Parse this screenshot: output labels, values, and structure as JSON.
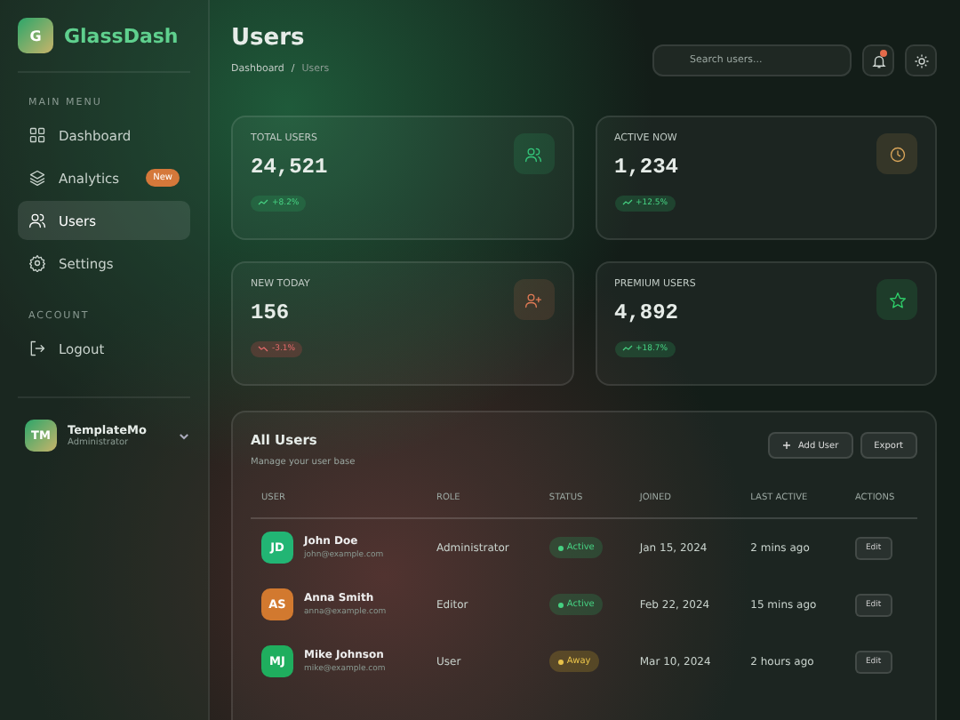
{
  "brand": {
    "logo_letter": "G",
    "name": "GlassDash"
  },
  "sidebar": {
    "sections": [
      {
        "title": "MAIN MENU",
        "items": [
          {
            "label": "Dashboard",
            "kind": "grid",
            "selected": false
          },
          {
            "label": "Analytics",
            "kind": "layers",
            "selected": false,
            "badge": "New"
          },
          {
            "label": "Users",
            "kind": "users",
            "selected": true
          },
          {
            "label": "Settings",
            "kind": "gear",
            "selected": false
          }
        ]
      },
      {
        "title": "ACCOUNT",
        "items": [
          {
            "label": "Logout",
            "kind": "logout",
            "selected": false
          }
        ]
      }
    ],
    "profile": {
      "initials": "TM",
      "name": "TemplateMo",
      "role": "Administrator"
    }
  },
  "header": {
    "title": "Users",
    "breadcrumb": [
      "Dashboard",
      "/",
      "Users"
    ],
    "search": {
      "placeholder": "Search users..."
    },
    "notification_dot": true
  },
  "stats": [
    {
      "label": "TOTAL USERS",
      "value": "24,521",
      "change": {
        "text": "+8.2%",
        "kind": "up"
      },
      "kind": "users",
      "color": "#34c77b"
    },
    {
      "label": "ACTIVE NOW",
      "value": "1,234",
      "change": {
        "text": "+12.5%",
        "kind": "up"
      },
      "kind": "clock",
      "color": "#d9a55a"
    },
    {
      "label": "NEW TODAY",
      "value": "156",
      "change": {
        "text": "-3.1%",
        "kind": "down"
      },
      "kind": "user-plus",
      "color": "#e07a55"
    },
    {
      "label": "PREMIUM USERS",
      "value": "4,892",
      "change": {
        "text": "+18.7%",
        "kind": "up"
      },
      "kind": "star",
      "color": "#2fcf6a"
    }
  ],
  "table": {
    "title": "All Users",
    "subtitle": "Manage your user base",
    "buttons": [
      {
        "label": "Add User",
        "kind": "add"
      },
      {
        "label": "Export",
        "kind": "plain"
      }
    ],
    "columns": [
      "USER",
      "ROLE",
      "STATUS",
      "JOINED",
      "LAST ACTIVE",
      "ACTIONS"
    ],
    "rows": [
      {
        "initials": "JD",
        "color": "#22b574",
        "name": "John Doe",
        "email": "john@example.com",
        "role": "Administrator",
        "status": {
          "text": "Active",
          "kind": "active"
        },
        "joined": "Jan 15, 2024",
        "last_active": "2 mins ago",
        "action": "Edit"
      },
      {
        "initials": "AS",
        "color": "#d2792f",
        "name": "Anna Smith",
        "email": "anna@example.com",
        "role": "Editor",
        "status": {
          "text": "Active",
          "kind": "active"
        },
        "joined": "Feb 22, 2024",
        "last_active": "15 mins ago",
        "action": "Edit"
      },
      {
        "initials": "MJ",
        "color": "#1fae5e",
        "name": "Mike Johnson",
        "email": "mike@example.com",
        "role": "User",
        "status": {
          "text": "Away",
          "kind": "away"
        },
        "joined": "Mar 10, 2024",
        "last_active": "2 hours ago",
        "action": "Edit"
      }
    ]
  }
}
